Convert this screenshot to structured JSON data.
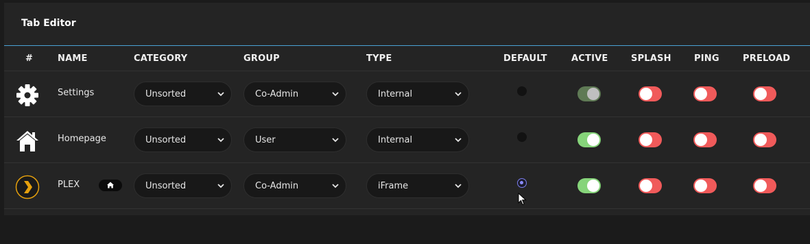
{
  "panel": {
    "title": "Tab Editor"
  },
  "columns": {
    "num": "#",
    "name": "NAME",
    "category": "CATEGORY",
    "group": "GROUP",
    "type": "TYPE",
    "default": "DEFAULT",
    "active": "ACTIVE",
    "splash": "SPLASH",
    "ping": "PING",
    "preload": "PRELOAD"
  },
  "rows": [
    {
      "icon": "gear-icon",
      "name": "Settings",
      "category": "Unsorted",
      "group": "Co-Admin",
      "type": "Internal",
      "default": false,
      "active": true,
      "active_disabled": true,
      "splash": false,
      "ping": false,
      "preload": false
    },
    {
      "icon": "home-icon",
      "name": "Homepage",
      "category": "Unsorted",
      "group": "User",
      "type": "Internal",
      "default": false,
      "active": true,
      "active_disabled": false,
      "splash": false,
      "ping": false,
      "preload": false
    },
    {
      "icon": "plex-icon",
      "name": "PLEX",
      "home_badge": "home-icon",
      "category": "Unsorted",
      "group": "Co-Admin",
      "type": "iFrame",
      "default": true,
      "active": true,
      "active_disabled": false,
      "splash": false,
      "ping": false,
      "preload": false
    }
  ],
  "colors": {
    "toggle_on": "#86d47a",
    "toggle_off": "#f05a5a",
    "header_line": "#4aa3d6",
    "radio_checked": "#7d7ff0"
  }
}
